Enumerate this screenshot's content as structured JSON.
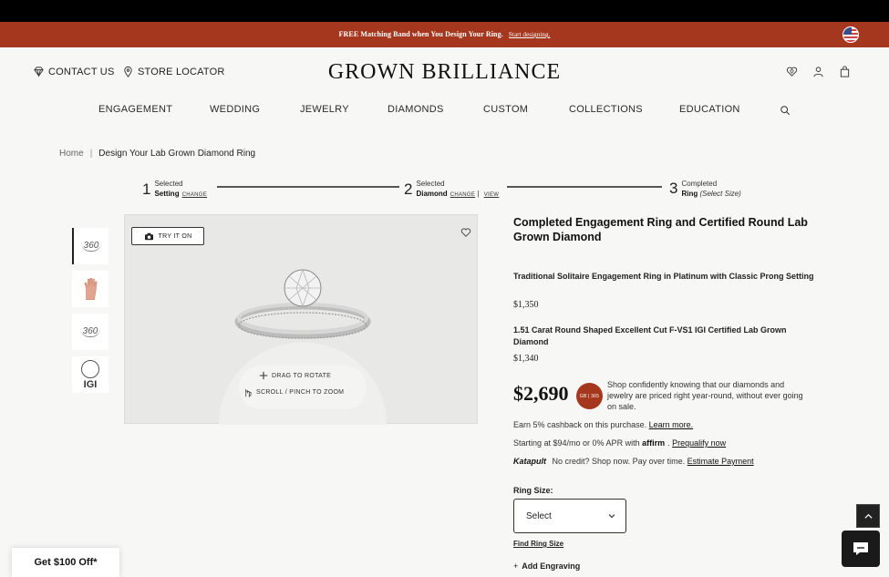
{
  "promo": {
    "message": "FREE Matching Band when You Design Your Ring.",
    "link": "Start designing."
  },
  "header": {
    "contact": "CONTACT US",
    "store": "STORE LOCATOR",
    "logo": "GROWN BRILLIANCE"
  },
  "nav": [
    "ENGAGEMENT",
    "WEDDING",
    "JEWELRY",
    "DIAMONDS",
    "CUSTOM",
    "COLLECTIONS",
    "EDUCATION"
  ],
  "breadcrumb": {
    "home": "Home",
    "current": "Design Your Lab Grown Diamond Ring"
  },
  "steps": [
    {
      "num": "1",
      "top": "Selected",
      "bottom": "Setting",
      "links": [
        "CHANGE"
      ]
    },
    {
      "num": "2",
      "top": "Selected",
      "bottom": "Diamond",
      "links": [
        "CHANGE",
        "VIEW"
      ]
    },
    {
      "num": "3",
      "top": "Completed",
      "bottom": "Ring",
      "note": "(Select Size)"
    }
  ],
  "thumbs": {
    "t1": "360",
    "t3": "360",
    "t4": "IGI"
  },
  "viewer": {
    "tryon": "TRY IT ON",
    "drag": "DRAG TO ROTATE",
    "zoom": "SCROLL / PINCH TO ZOOM"
  },
  "product": {
    "title": "Completed Engagement Ring and Certified Round Lab Grown Diamond",
    "setting_name": "Traditional Solitaire Engagement Ring in Platinum with Classic Prong Setting",
    "setting_price": "$1,350",
    "diamond_name": "1.51 Carat Round Shaped Excellent Cut F-VS1 IGI Certified Lab Grown Diamond",
    "diamond_price": "$1,340",
    "total": "$2,690",
    "badge": "GB | 365",
    "assurance": "Shop confidently knowing that our diamonds and jewelry are priced right year-round, without ever going on sale.",
    "cashback": "Earn 5% cashback on this purchase.",
    "cashback_link": "Learn more.",
    "financing": "Starting at $94/mo or 0% APR with",
    "affirm": "affirm",
    "prequalify": "Prequalify now",
    "katapult": "Katapult",
    "katapult_text": "No credit? Shop now. Pay over time.",
    "estimate": "Estimate Payment",
    "ring_size_label": "Ring Size:",
    "ring_size_value": "Select",
    "find_size": "Find Ring Size",
    "engraving": "Add Engraving"
  },
  "widgets": {
    "discount": "Get $100 Off*"
  },
  "colors": {
    "promo_bg": "#a5371f",
    "badge": "#a5371f",
    "topbar": "#000000"
  }
}
